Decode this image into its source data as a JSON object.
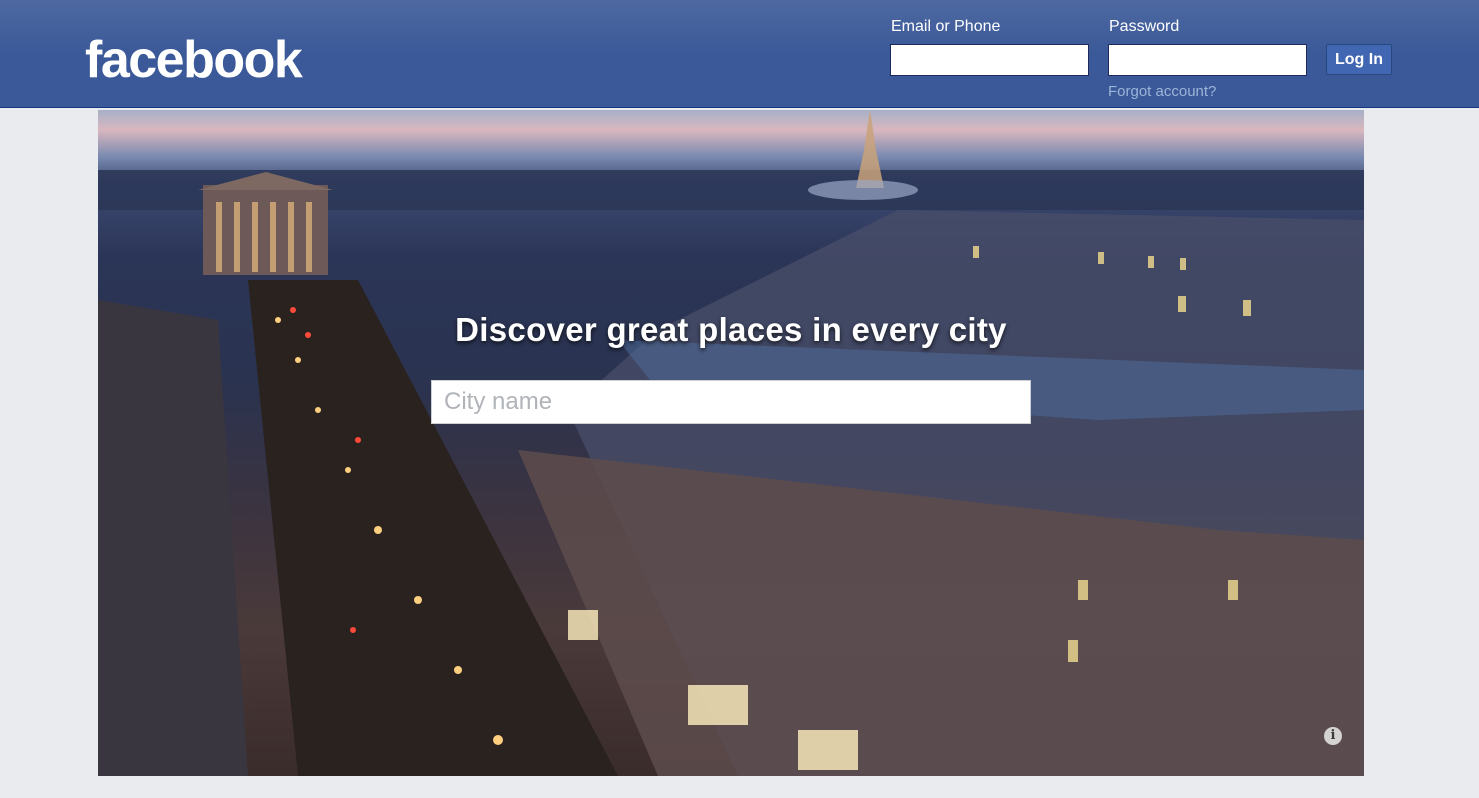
{
  "header": {
    "logo_text": "facebook",
    "email_label": "Email or Phone",
    "email_value": "",
    "password_label": "Password",
    "password_value": "",
    "login_button": "Log In",
    "forgot_link": "Forgot account?",
    "brand_color": "#3b5998"
  },
  "hero": {
    "title": "Discover great places in every city",
    "search_placeholder": "City name",
    "search_value": "",
    "info_icon": "info-icon"
  }
}
